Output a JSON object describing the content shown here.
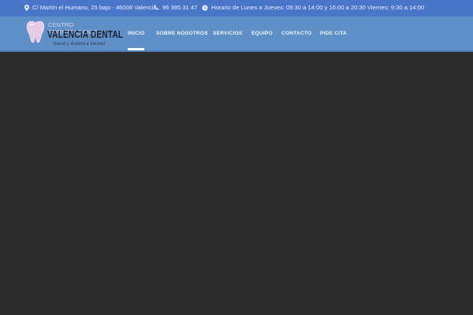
{
  "topbar": {
    "address": "C/ Martín el Humano, 25 bajo - 46008 Valencia",
    "phone": "96 385 31 47",
    "hours": "Horario de Lunes a Jueves: 09:30 a 14:00 y 16:00 a 20:30 Viernes: 9:30 a 14:00",
    "icons": [
      "map-pin-icon",
      "phone-icon",
      "clock-icon"
    ]
  },
  "logo": {
    "line1": "CENTRO ODONTOLÓGICO",
    "line2": "VALENCIA DENTAL",
    "line3": "Salud y Estética Dental"
  },
  "nav": {
    "items": [
      {
        "label": "INICIO",
        "active": true
      },
      {
        "label": "SOBRE NOSOTROS",
        "active": false
      },
      {
        "label": "SERVICIOS",
        "active": false
      },
      {
        "label": "EQUIPO",
        "active": false
      },
      {
        "label": "CONTACTO",
        "active": false
      },
      {
        "label": "PIDE CITA",
        "active": false
      }
    ]
  },
  "colors": {
    "topbar": "#4a76c9",
    "header": "#5e8fc6",
    "hero": "#2b2b2b",
    "nav_text": "#f0f4fb"
  }
}
